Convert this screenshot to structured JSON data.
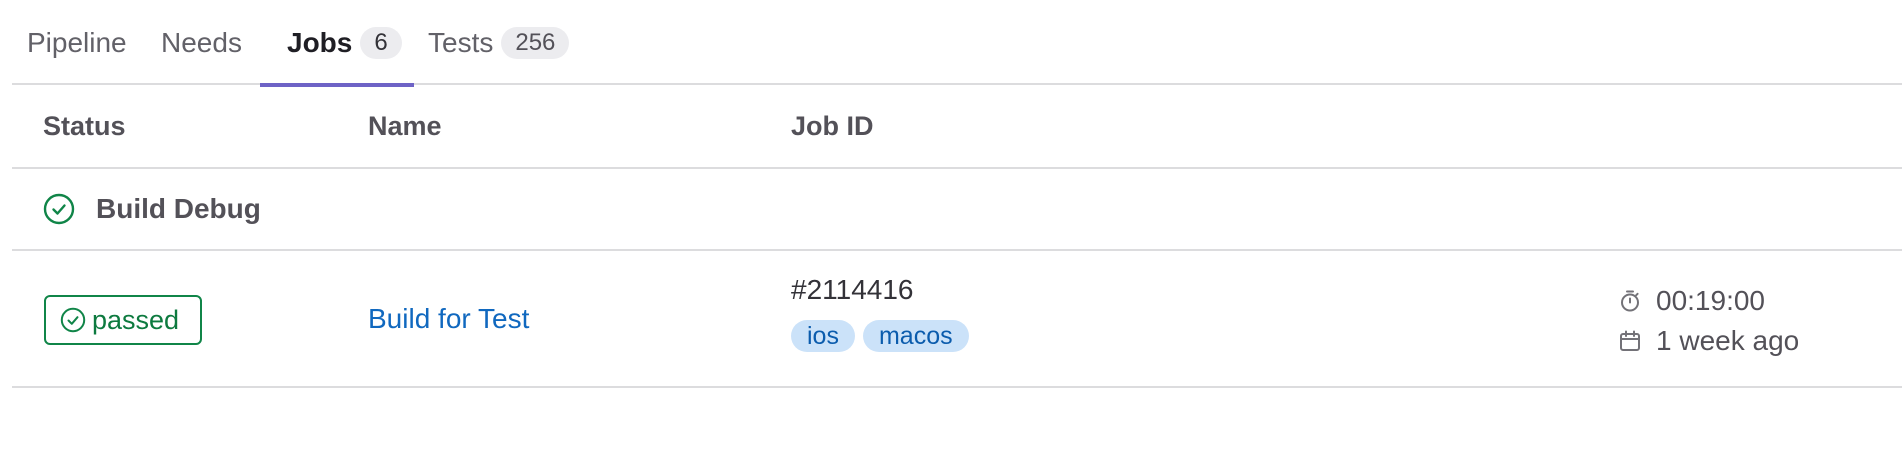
{
  "tabs": [
    {
      "label": "Pipeline"
    },
    {
      "label": "Needs"
    },
    {
      "label": "Jobs",
      "count": "6",
      "active": true
    },
    {
      "label": "Tests",
      "count": "256"
    }
  ],
  "table": {
    "headers": {
      "status": "Status",
      "name": "Name",
      "job_id": "Job ID"
    },
    "group": {
      "title": "Build Debug",
      "status_icon": "check-circle-icon"
    },
    "jobs": [
      {
        "status": "passed",
        "status_icon": "check-circle-icon",
        "name": "Build for Test",
        "job_id": "#2114416",
        "tags": [
          "ios",
          "macos"
        ],
        "duration": "00:19:00",
        "duration_icon": "timer-icon",
        "finished": "1 week ago",
        "finished_icon": "calendar-icon"
      }
    ]
  },
  "colors": {
    "success": "#108548",
    "link": "#1068bf",
    "tab_underline": "#6e63c6",
    "tag_bg": "#cbe2f9"
  }
}
